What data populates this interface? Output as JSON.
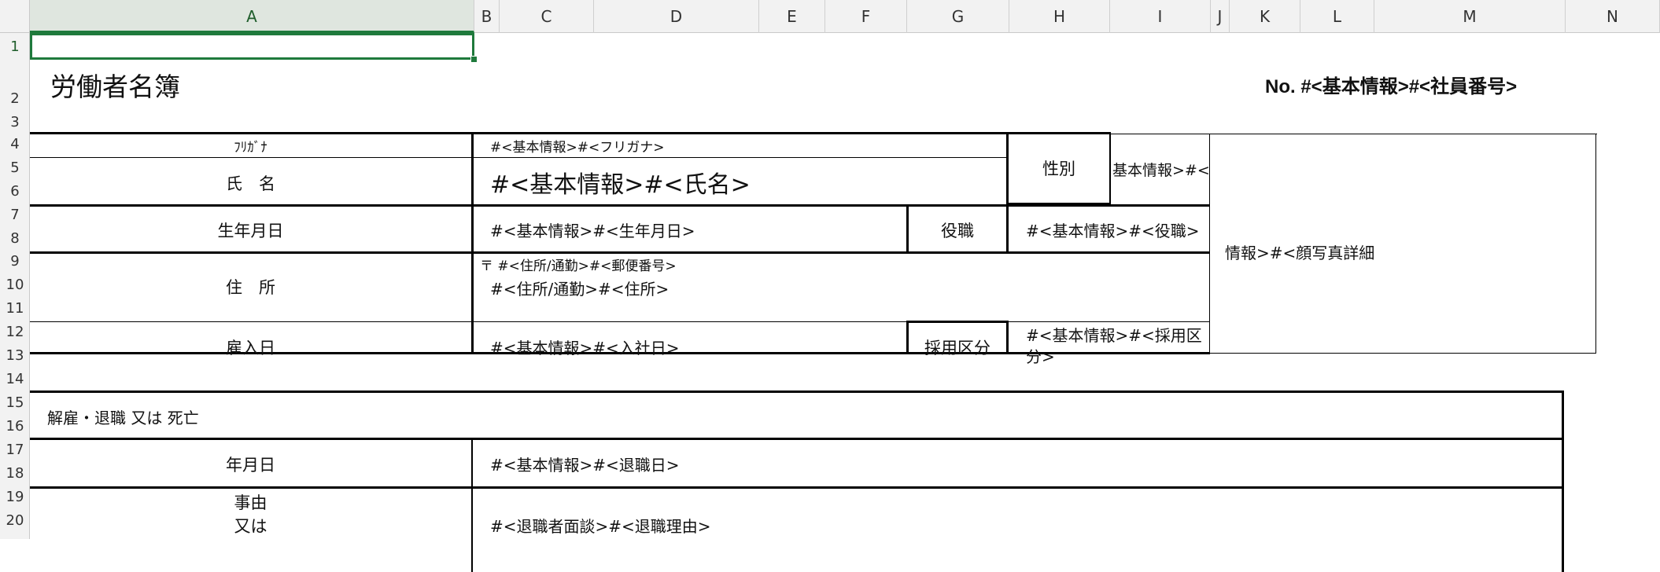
{
  "columns": [
    "A",
    "B",
    "C",
    "D",
    "E",
    "F",
    "G",
    "H",
    "I",
    "J",
    "K",
    "L",
    "M",
    "N"
  ],
  "rows": [
    "1",
    "2",
    "3",
    "4",
    "5",
    "6",
    "7",
    "8",
    "9",
    "10",
    "11",
    "12",
    "13",
    "14",
    "15",
    "16",
    "17",
    "18",
    "19",
    "20"
  ],
  "sheet": {
    "title": "労働者名簿",
    "number": "No. #<基本情報>#<社員番号>",
    "labels": {
      "furigana": "ﾌﾘｶﾞﾅ",
      "name": "氏　名",
      "gender": "性別",
      "birthdate": "生年月日",
      "position": "役職",
      "address": "住　所",
      "hire_date": "雇入日",
      "employment_type": "採用区分",
      "dismissal_header": "解雇・退職 又は 死亡",
      "date": "年月日",
      "reason_1": "事由",
      "reason_2": "又は"
    },
    "values": {
      "furigana": "#<基本情報>#<フリガナ>",
      "name": "#<基本情報>#<氏名>",
      "gender": "基本情報>#<性",
      "birthdate": "#<基本情報>#<生年月日>",
      "position": "#<基本情報>#<役職>",
      "postal": "〒 #<住所/通勤>#<郵便番号>",
      "address": "#<住所/通勤>#<住所>",
      "hire_date": "#<基本情報>#<入社日>",
      "employment_type_1": "#<基本情報>#<採用区",
      "employment_type_2": "分>",
      "photo": "情報>#<顔写真詳細",
      "retire_date": "#<基本情報>#<退職日>",
      "retire_reason": "#<退職者面談>#<退職理由>"
    }
  }
}
